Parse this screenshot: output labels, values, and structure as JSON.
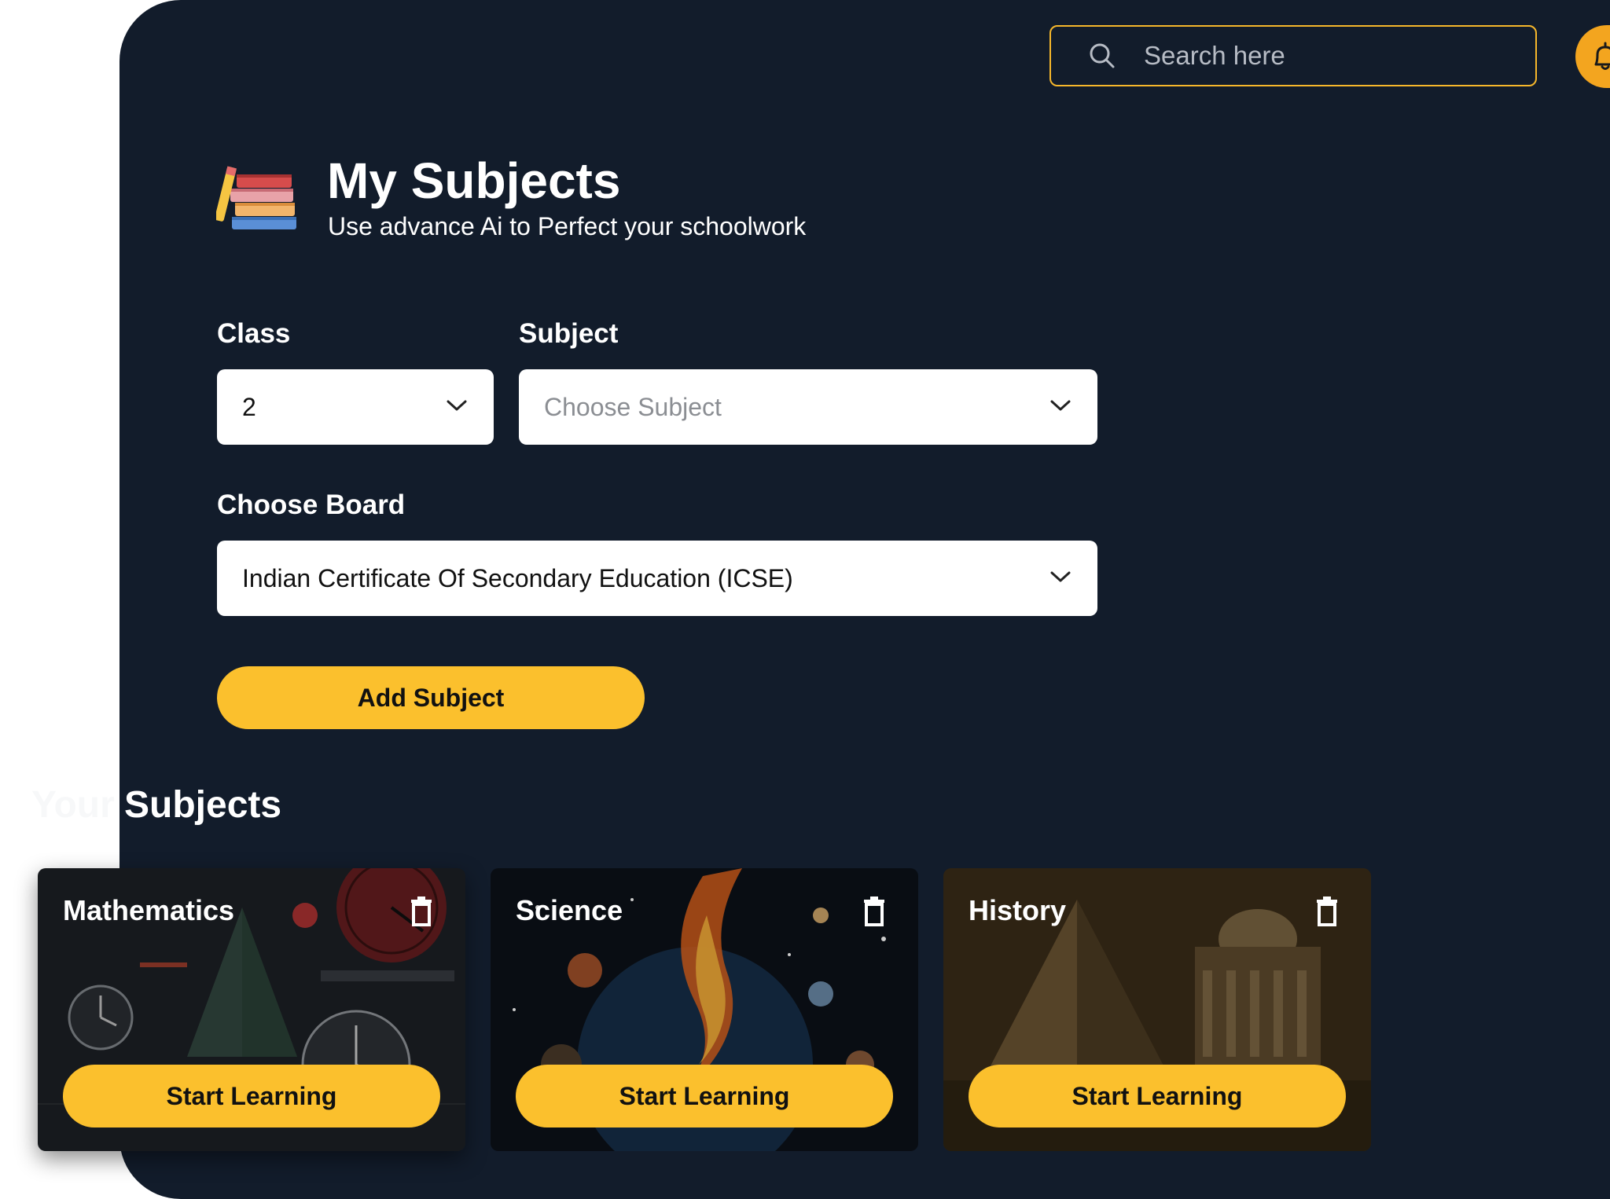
{
  "search": {
    "placeholder": "Search here",
    "icon": "search-icon"
  },
  "notifications": {
    "icon": "bell-icon"
  },
  "header": {
    "icon": "books-icon",
    "title": "My Subjects",
    "subtitle": "Use advance Ai to Perfect your schoolwork"
  },
  "form": {
    "class_label": "Class",
    "class_value": "2",
    "subject_label": "Subject",
    "subject_placeholder": "Choose Subject",
    "board_label": "Choose Board",
    "board_value": "Indian Certificate Of Secondary Education (ICSE)",
    "add_button": "Add Subject"
  },
  "your_subjects": {
    "title_prefix": "Your",
    "title": "Subjects",
    "cards": [
      {
        "name": "Mathematics",
        "action": "Start Learning",
        "delete_icon": "trash-icon"
      },
      {
        "name": "Science",
        "action": "Start Learning",
        "delete_icon": "trash-icon"
      },
      {
        "name": "History",
        "action": "Start Learning",
        "delete_icon": "trash-icon"
      }
    ]
  },
  "colors": {
    "background": "#121c2b",
    "accent": "#fbc02d",
    "search_border": "#f6b72b",
    "bell": "#f3a51f"
  }
}
